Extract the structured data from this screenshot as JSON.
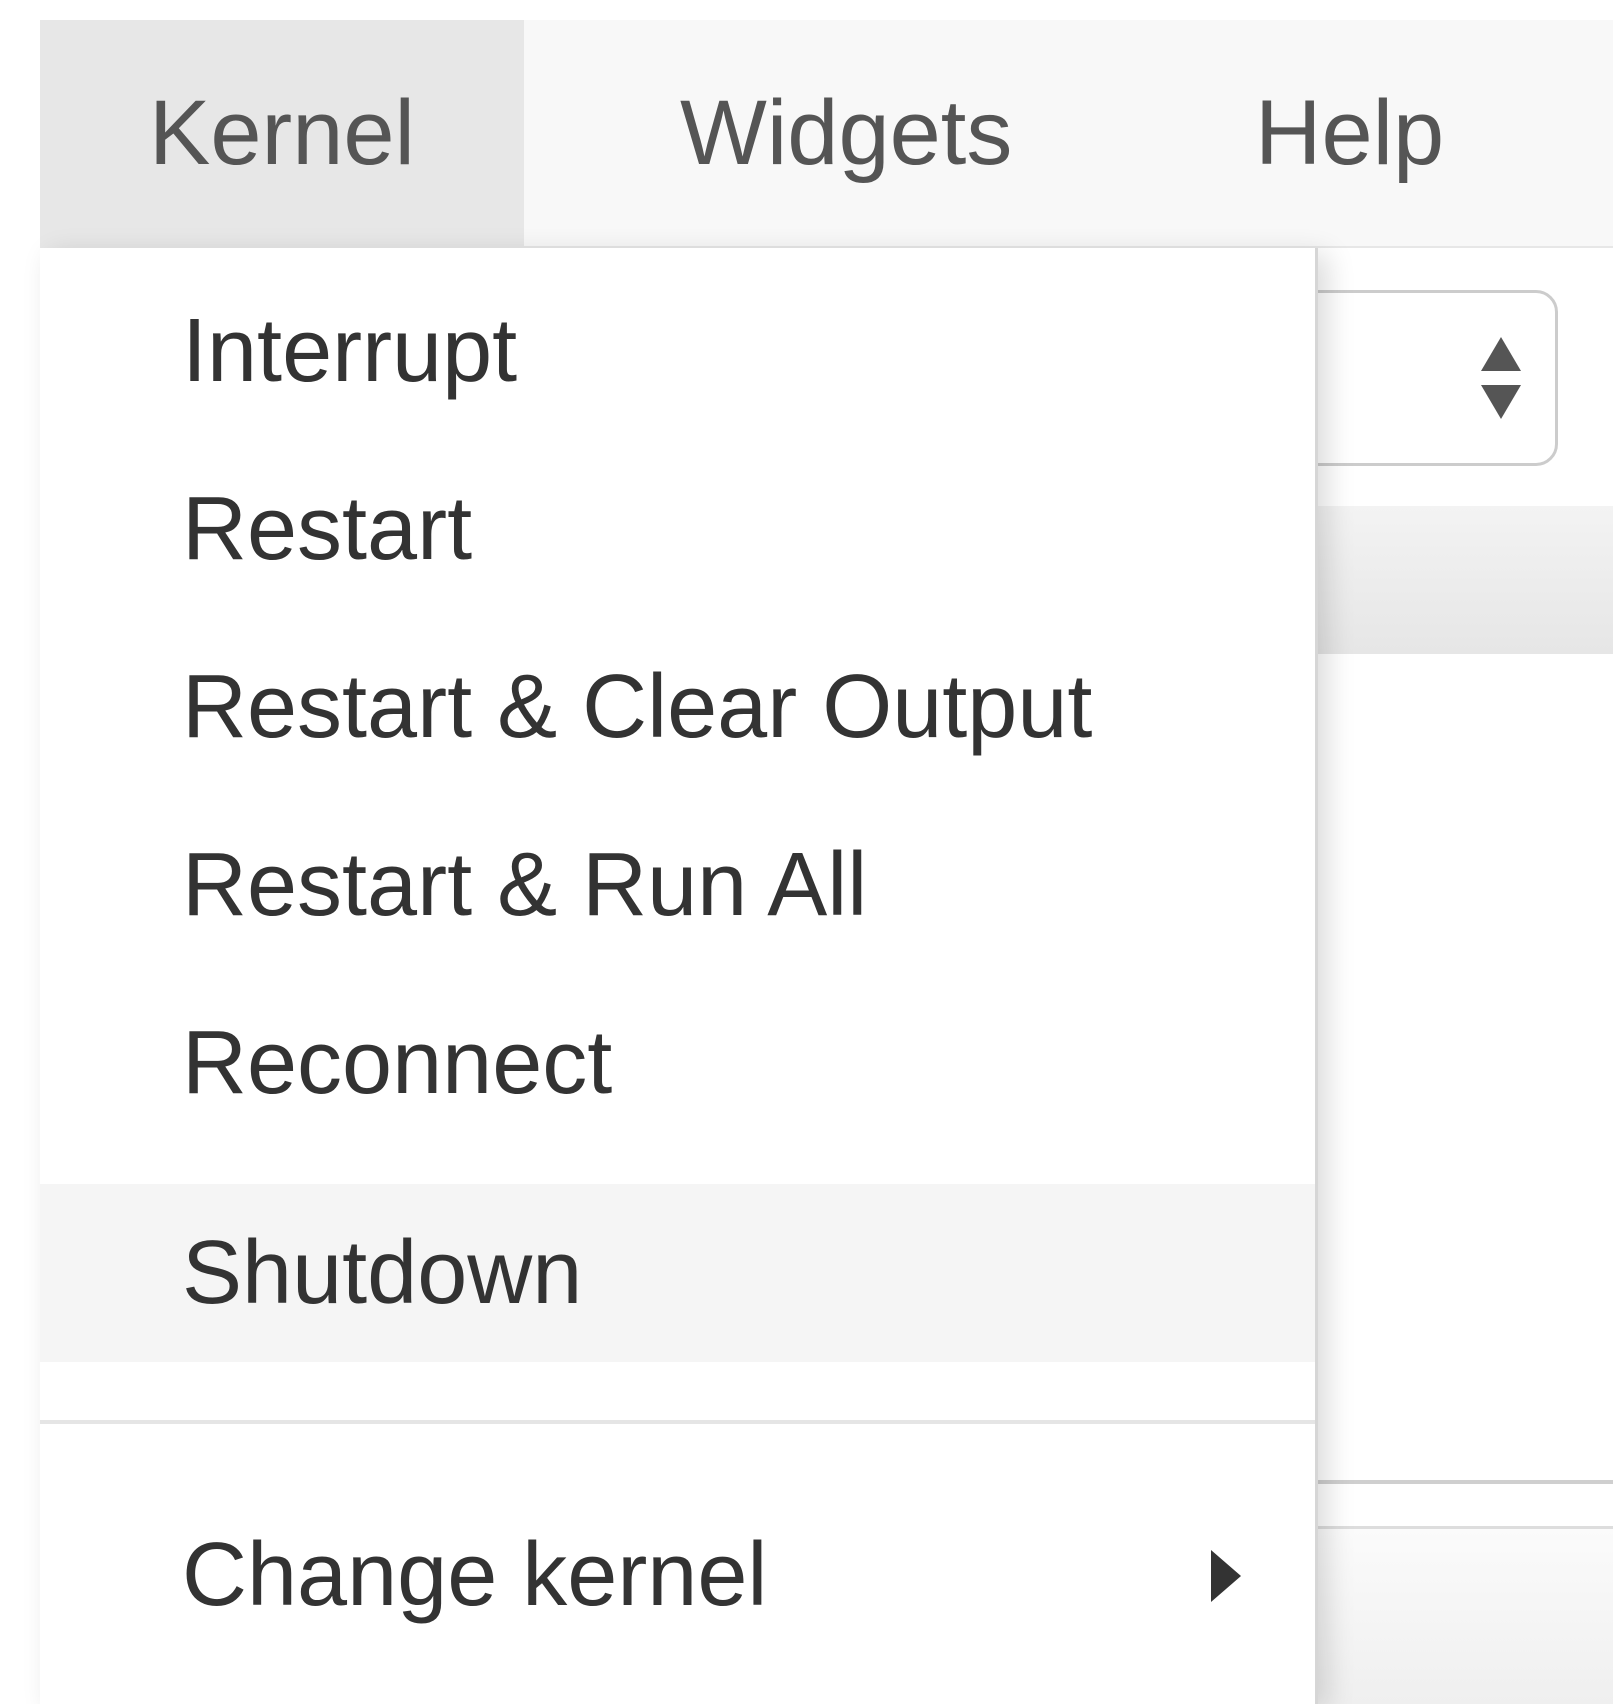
{
  "menubar": {
    "items": [
      {
        "label": "Kernel",
        "active": true
      },
      {
        "label": "Widgets",
        "active": false
      },
      {
        "label": "Help",
        "active": false
      }
    ]
  },
  "kernel_menu": {
    "items": [
      {
        "label": "Interrupt"
      },
      {
        "label": "Restart"
      },
      {
        "label": "Restart & Clear Output"
      },
      {
        "label": "Restart & Run All"
      },
      {
        "label": "Reconnect"
      },
      {
        "label": "Shutdown",
        "highlighted": true
      }
    ],
    "submenu": {
      "label": "Change kernel",
      "icon": "caret-right-icon"
    }
  },
  "background": {
    "select_icon": "select-arrows-icon"
  },
  "colors": {
    "menubar_bg": "#f8f8f8",
    "menubar_active_bg": "#e7e7e7",
    "menu_text": "#333333",
    "hover_bg": "#f5f5f5"
  }
}
